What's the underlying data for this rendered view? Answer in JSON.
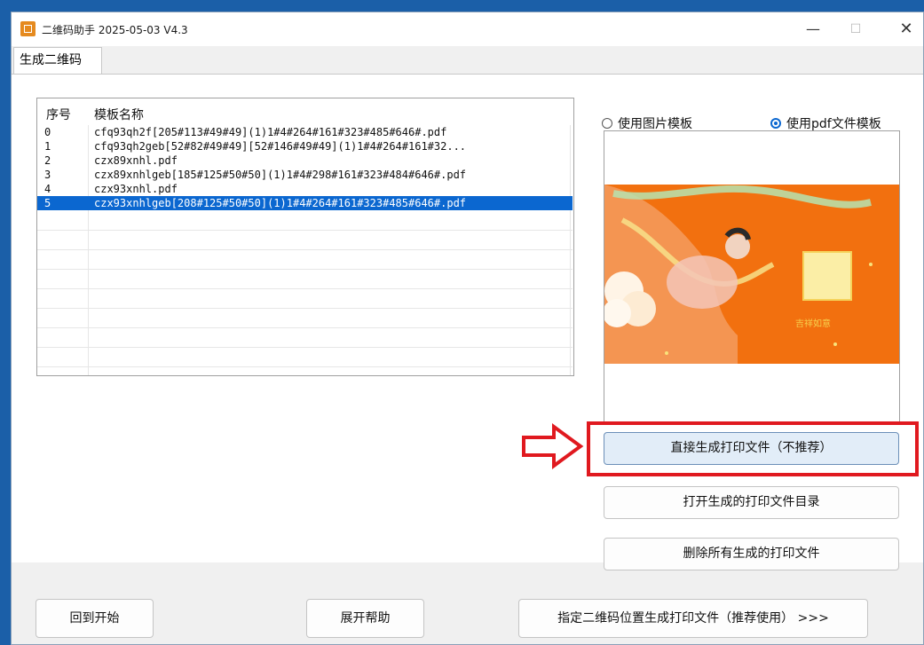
{
  "window": {
    "title": "二维码助手 2025-05-03 V4.3"
  },
  "tab": {
    "label": "生成二维码"
  },
  "list": {
    "headers": [
      "序号",
      "模板名称"
    ],
    "rows": [
      {
        "index": "0",
        "name": "cfq93qh2f[205#113#49#49](1)1#4#264#161#323#485#646#.pdf"
      },
      {
        "index": "1",
        "name": "cfq93qh2geb[52#82#49#49][52#146#49#49](1)1#4#264#161#32..."
      },
      {
        "index": "2",
        "name": "czx89xnhl.pdf"
      },
      {
        "index": "3",
        "name": "czx89xnhlgeb[185#125#50#50](1)1#4#298#161#323#484#646#.pdf"
      },
      {
        "index": "4",
        "name": "czx93xnhl.pdf"
      },
      {
        "index": "5",
        "name": "czx93xnhlgeb[208#125#50#50](1)1#4#264#161#323#485#646#.pdf"
      }
    ],
    "selected_index": 5
  },
  "radios": {
    "image_template": "使用图片模板",
    "pdf_template": "使用pdf文件模板",
    "selected": "pdf_template"
  },
  "preview": {
    "caption": "吉祥如意"
  },
  "buttons": {
    "direct_generate": "直接生成打印文件（不推荐）",
    "open_dir": "打开生成的打印文件目录",
    "third_partial": "删除所有生成的打印文件",
    "back_to_start": "回到开始",
    "expand_help": "展开帮助",
    "specify_position": "指定二维码位置生成打印文件（推荐使用） >>>"
  },
  "colors": {
    "accent": "#0b67d0",
    "highlight": "#e0191f",
    "preview_bg": "#f2700f"
  }
}
